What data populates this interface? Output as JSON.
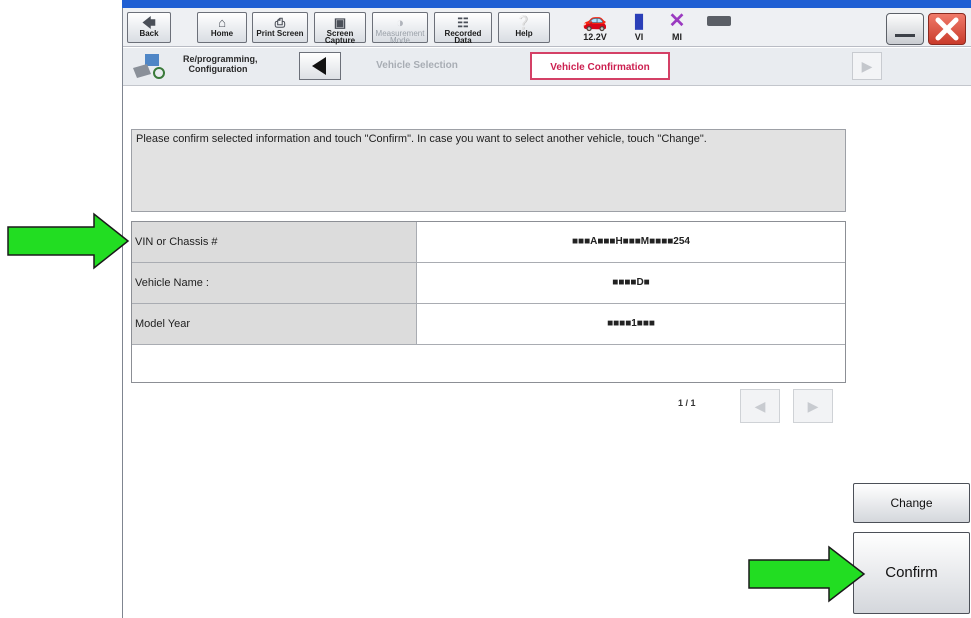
{
  "toolbar": {
    "back": "Back",
    "home": "Home",
    "print_screen": "Print Screen",
    "screen_capture": "Screen\nCapture",
    "measurement_mode": "Measurement\nMode",
    "recorded_data": "Recorded\nData",
    "help": "Help"
  },
  "status": {
    "voltage": "12.2V",
    "vi": "VI",
    "mi": "MI"
  },
  "nav": {
    "title": "Re/programming,\nConfiguration",
    "step_prev": "Vehicle Selection",
    "step_current": "Vehicle Confirmation"
  },
  "message": "Please confirm selected information and touch \"Confirm\". In case you want to select another vehicle, touch \"Change\".",
  "table": {
    "rows": [
      {
        "label": "VIN or Chassis #",
        "value": "■■■A■■■H■■■M■■■■254"
      },
      {
        "label": "Vehicle Name :",
        "value": "■■■■D■"
      },
      {
        "label": "Model Year",
        "value": "■■■■1■■■"
      }
    ]
  },
  "pager": {
    "text": "1 / 1"
  },
  "actions": {
    "change": "Change",
    "confirm": "Confirm"
  },
  "colors": {
    "arrow": "#22dd22",
    "current_step": "#d44066",
    "close": "#e14b3b"
  }
}
